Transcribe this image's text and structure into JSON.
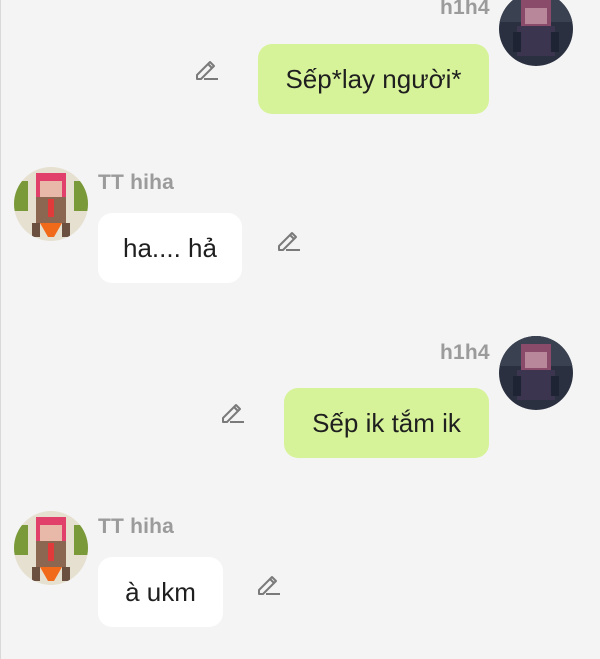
{
  "conversation": {
    "messages": [
      {
        "sender": "h1h4",
        "text": "Sếp*lay người*",
        "side": "outgoing"
      },
      {
        "sender": "TT hiha",
        "text": "ha.... hả",
        "side": "incoming"
      },
      {
        "sender": "h1h4",
        "text": "Sếp ik tắm ik",
        "side": "outgoing"
      },
      {
        "sender": "TT hiha",
        "text": "à ukm",
        "side": "incoming"
      }
    ]
  },
  "icons": {
    "edit": "pencil-edit-icon",
    "avatar_outgoing": "avatar-dark-character",
    "avatar_incoming": "avatar-pink-hair-character"
  },
  "colors": {
    "outgoing_bubble": "#d7f39a",
    "incoming_bubble": "#ffffff",
    "background": "#f4f4f4",
    "name_text": "#9b9b9b"
  }
}
